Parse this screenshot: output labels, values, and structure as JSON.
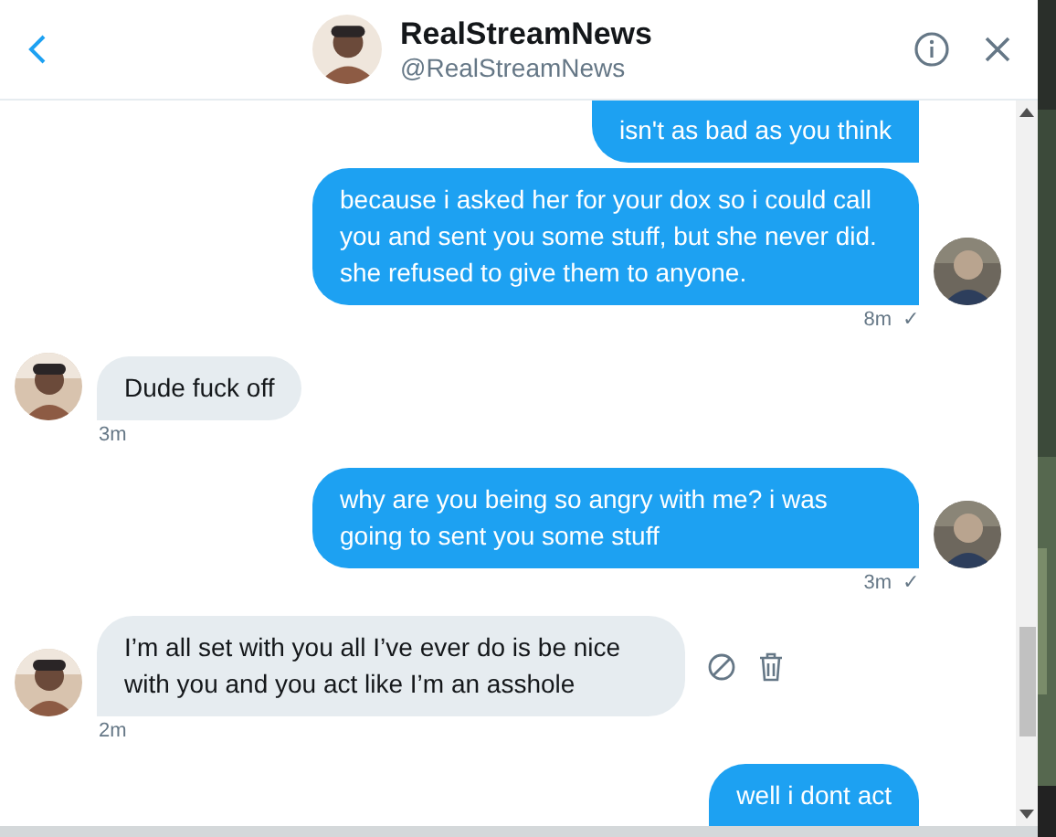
{
  "header": {
    "name": "RealStreamNews",
    "handle": "@RealStreamNews"
  },
  "messages": [
    {
      "kind": "sent",
      "text": "isn't as bad as you think",
      "avatar": false,
      "show_actions": false
    },
    {
      "kind": "sent",
      "text": "because i asked her for your dox so i could call you and sent you some stuff, but she never did. she refused to give them to anyone.",
      "time": "8m",
      "status": "✓",
      "avatar": true,
      "show_actions": false
    },
    {
      "kind": "received",
      "text": "Dude fuck off",
      "time": "3m",
      "avatar": true,
      "show_actions": false
    },
    {
      "kind": "sent",
      "text": "why are you being so angry with me? i was going to sent you some stuff",
      "time": "3m",
      "status": "✓",
      "avatar": true,
      "show_actions": false
    },
    {
      "kind": "received",
      "text": "I’m all set with you all I’ve ever do is be nice with you and you act like I’m an asshole",
      "time": "2m",
      "avatar": true,
      "show_actions": true
    },
    {
      "kind": "sent",
      "text": "well i dont act",
      "avatar": false,
      "show_actions": false
    }
  ]
}
